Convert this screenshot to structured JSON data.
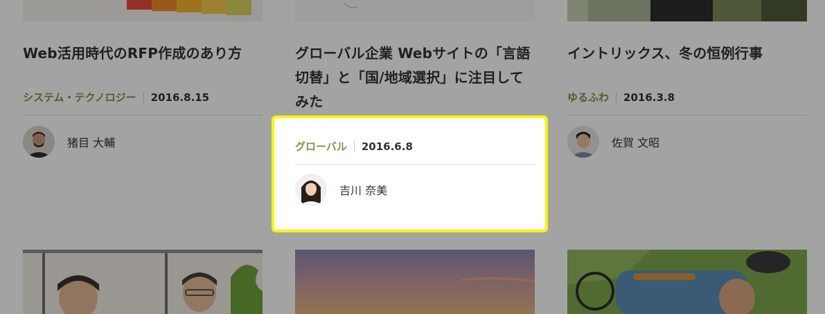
{
  "articles": [
    {
      "title": "Web活用時代のRFP作成のあり方",
      "category": "システム・テクノロジー",
      "date": "2016.8.15",
      "author": "猪目 大輔"
    },
    {
      "title": "グローバル企業 Webサイトの「言語切替」と「国/地域選択」に注目してみた",
      "category": "グローバル",
      "date": "2016.6.8",
      "author": "吉川 奈美"
    },
    {
      "title": "イントリックス、冬の恒例行事",
      "category": "ゆるふわ",
      "date": "2016.3.8",
      "author": "佐賀 文昭"
    }
  ],
  "colors": {
    "category": "#8f8a4c",
    "highlight_border": "#f8f50a",
    "overlay": "rgba(0,0,0,0.36)"
  }
}
